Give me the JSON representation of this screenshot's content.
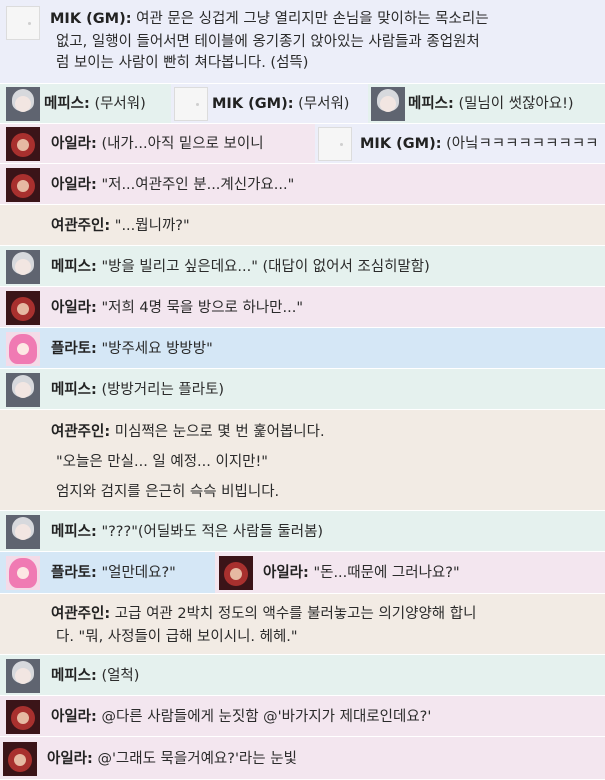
{
  "speakers": {
    "gm": "MIK (GM):",
    "mephis": "메피스:",
    "aila": "아일라:",
    "innkeeper": "여관주인:",
    "plato": "플라토:"
  },
  "messages": {
    "m1_l1": "여관 문은 싱겁게 그냥 열리지만 손님을 맞이하는 목소리는",
    "m1_l2": "없고, 일행이 들어서면 테이블에 옹기종기 앉아있는 사람들과 종업원처",
    "m1_l3": "럼 보이는 사람이 빤히 쳐다봅니다. (섬뜩)",
    "m2a": "(무서워)",
    "m2b": "(무서워)",
    "m2c": "(밀님이 썻잖아요!)",
    "m3a": "(내가...아직 밑으로 보이니",
    "m3b": "(아닠ㅋㅋㅋㅋㅋㅋㅋㅋㅋ",
    "m4": "\"저...여관주인 분...계신가요...\"",
    "m5": "\"...뭡니까?\"",
    "m6": "\"방을 빌리고 싶은데요...\" (대답이 없어서 조심히말함)",
    "m7": "\"저희 4명 묵을 방으로 하나만...\"",
    "m8": "\"방주세요 방방방\"",
    "m9": "(방방거리는 플라토)",
    "m10_l1": "미심쩍은 눈으로 몇 번 훑어봅니다.",
    "m10_l2": "\"오늘은 만실... 일 예정... 이지만!\"",
    "m10_l3": "엄지와 검지를 은근히 슥슥 비빕니다.",
    "m11": "\"???\"(어딜봐도 적은 사람들 둘러봄)",
    "m12a": "\"얼만데요?\"",
    "m12b": "\"돈...때문에 그러나요?\"",
    "m13_l1": "고급 여관 2박치 정도의 액수를 불러놓고는 의기양양해 합니",
    "m13_l2": "다.  \"뭐, 사정들이 급해 보이시니. 헤헤.\"",
    "m14": "(얼척)",
    "m15": "@다른 사람들에게 눈짓함   @'바가지가 제대로인데요?'",
    "m16": "@'그래도 묵을거예요?'라는 눈빛"
  },
  "colors": {
    "gm": "#eceef9",
    "mephis": "#e5f1ee",
    "aila": "#f3e6ef",
    "innkeeper": "#f2ebe4",
    "plato": "#d5e7f6"
  }
}
